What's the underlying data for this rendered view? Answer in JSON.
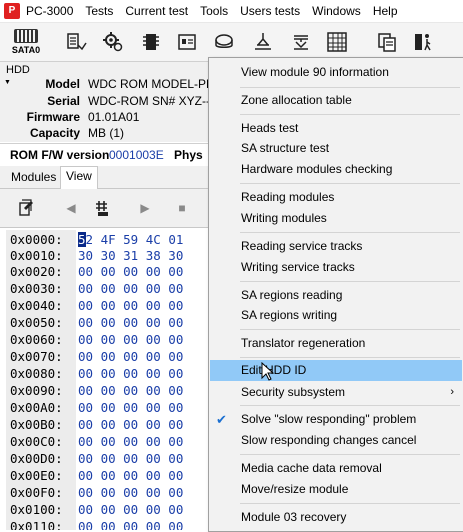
{
  "menubar": {
    "logo": "P",
    "items": [
      "PC-3000",
      "Tests",
      "Current test",
      "Tools",
      "Users tests",
      "Windows",
      "Help"
    ]
  },
  "toolbar": {
    "sata_label": "SATA0",
    "icons": [
      "sata-icon",
      "modules-icon",
      "settings-icon",
      "chip-icon",
      "id-card-icon",
      "hdd-icon",
      "transistor-icon",
      "capacitor-icon",
      "grid-icon",
      "copy-icon",
      "exit-icon"
    ]
  },
  "hdd": {
    "caption": "HDD",
    "rows": [
      {
        "key": "Model",
        "value": "WDC ROM MODEL-PEE"
      },
      {
        "key": "Serial",
        "value": "WDC-ROM SN# XYZ---"
      },
      {
        "key": "Firmware",
        "value": "01.01A01"
      },
      {
        "key": "Capacity",
        "value": "MB (1)"
      }
    ]
  },
  "rom": {
    "key": "ROM F/W version",
    "value": "0001003E",
    "phys": "Phys"
  },
  "tabs": {
    "modules": "Modules",
    "view": "View"
  },
  "hex": {
    "offsets": [
      "0x0000:",
      "0x0010:",
      "0x0020:",
      "0x0030:",
      "0x0040:",
      "0x0050:",
      "0x0060:",
      "0x0070:",
      "0x0080:",
      "0x0090:",
      "0x00A0:",
      "0x00B0:",
      "0x00C0:",
      "0x00D0:",
      "0x00E0:",
      "0x00F0:",
      "0x0100:",
      "0x0110:"
    ],
    "first_cursor": "5",
    "rows": [
      "2 4F 59 4C 01",
      "30 30 31 38 30",
      "00 00 00 00 00",
      "00 00 00 00 00",
      "00 00 00 00 00",
      "00 00 00 00 00",
      "00 00 00 00 00",
      "00 00 00 00 00",
      "00 00 00 00 00",
      "00 00 00 00 00",
      "00 00 00 00 00",
      "00 00 00 00 00",
      "00 00 00 00 00",
      "00 00 00 00 00",
      "00 00 00 00 00",
      "00 00 00 00 00",
      "00 00 00 00 00",
      "00 00 00 00 00"
    ]
  },
  "context_menu": {
    "items": [
      "View module 90 information",
      "Zone allocation table",
      "Heads test",
      "SA structure test",
      "Hardware modules checking",
      "Reading modules",
      "Writing modules",
      "Reading service tracks",
      "Writing service tracks",
      "SA regions reading",
      "SA regions writing",
      "Translator regeneration",
      "Edit HDD ID",
      "Security subsystem",
      "Solve \"slow responding\" problem",
      "Slow responding changes cancel",
      "Media cache data removal",
      "Move/resize module",
      "Module 03 recovery"
    ],
    "checkmark": "✔",
    "submenu_arrow": "›",
    "highlight_color": "#91c9f7"
  }
}
